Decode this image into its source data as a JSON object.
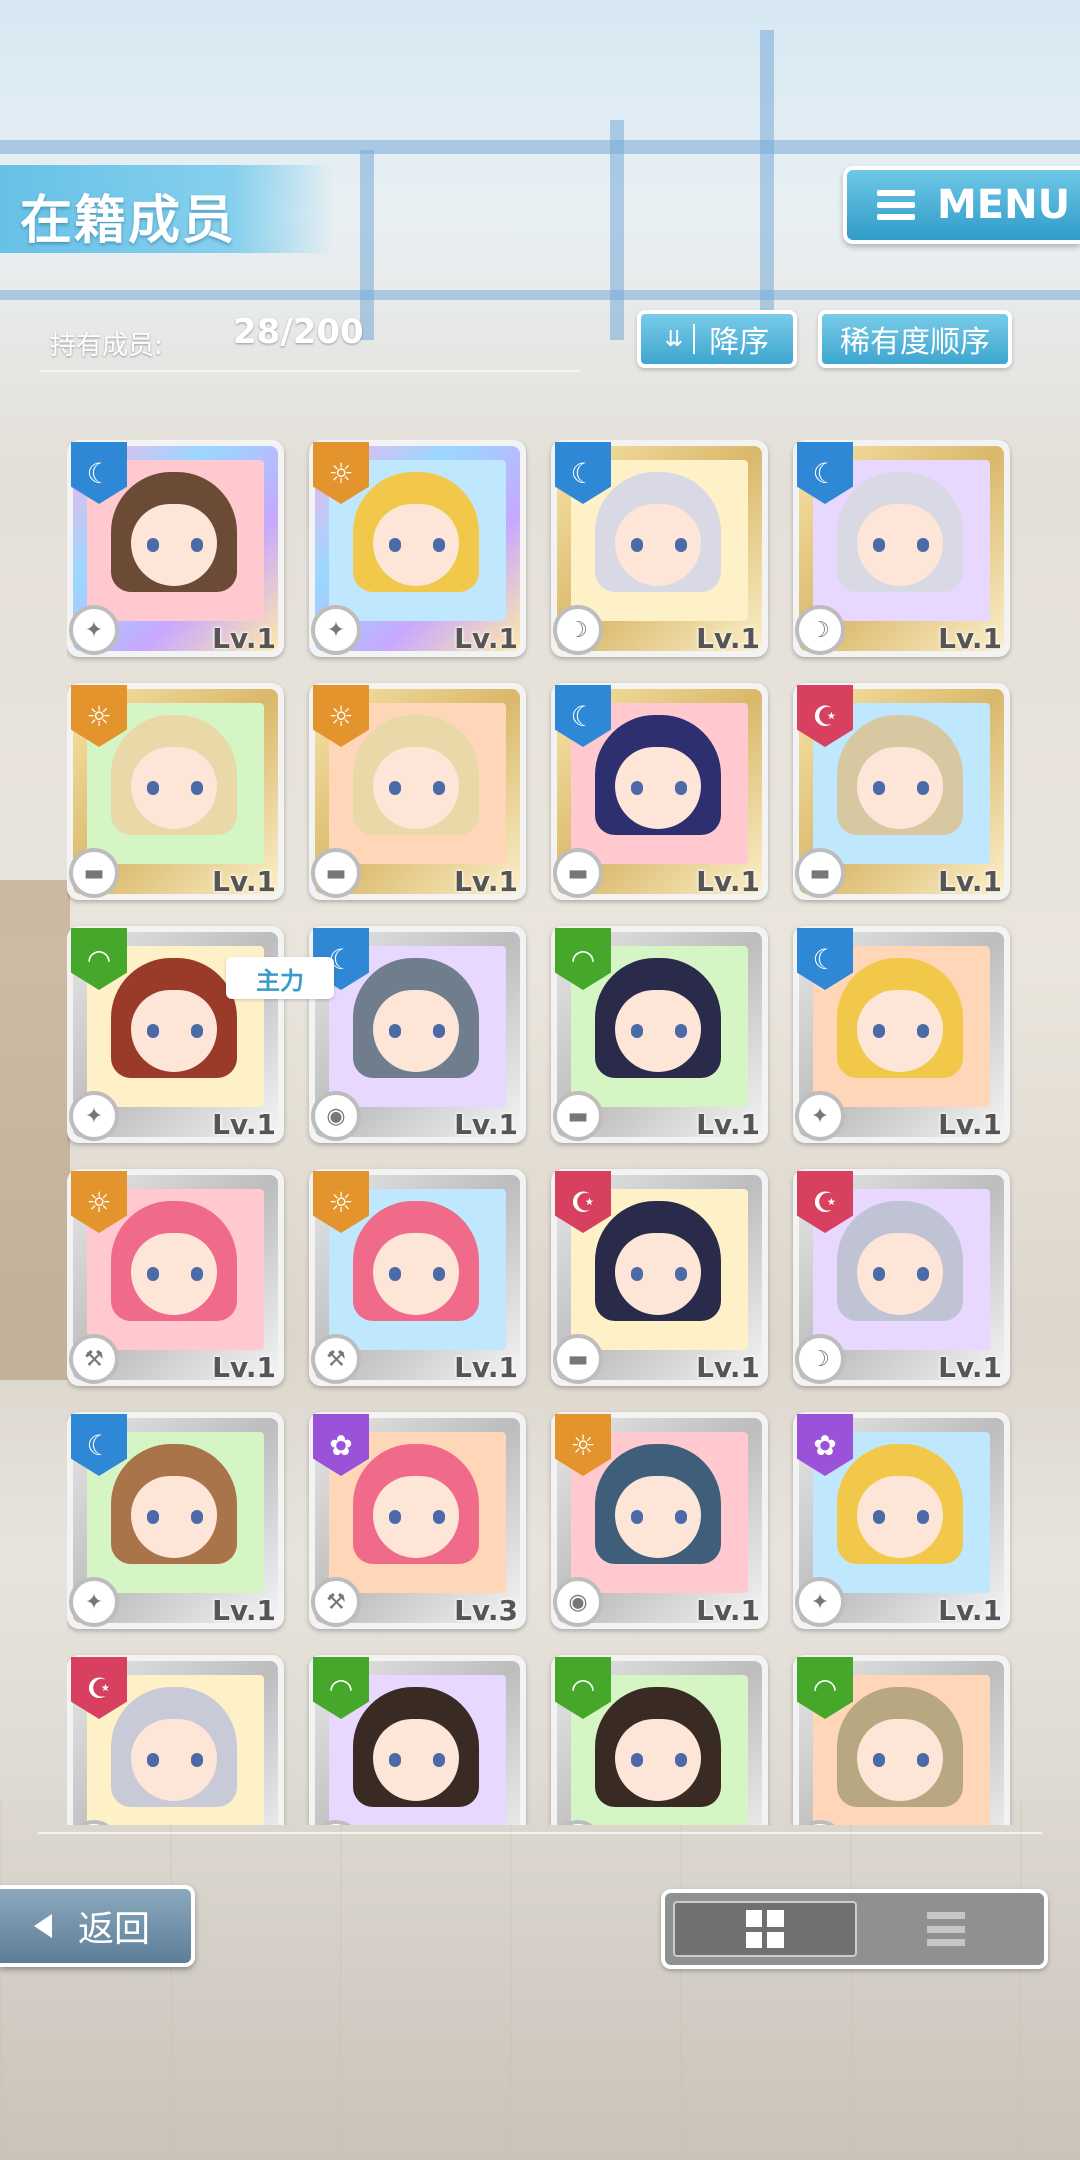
{
  "header": {
    "title": "在籍成员",
    "menu_label": "MENU"
  },
  "roster": {
    "count_label": "持有成员:",
    "count_value": "28/200"
  },
  "sort": {
    "order_label": "降序",
    "rarity_label": "稀有度顺序"
  },
  "main_tag": "主力",
  "footer": {
    "back_label": "返回"
  },
  "colors": {
    "accent": "#3ea6cf",
    "attr_blue": "#2f88d6",
    "attr_orange": "#e3942c",
    "attr_green": "#45a82a",
    "attr_pink": "#d8405f",
    "attr_purple": "#9a52d8"
  },
  "cards": [
    {
      "attr": "blue",
      "weapon": "sword-icon",
      "level": "Lv.1",
      "frame": "rainbow"
    },
    {
      "attr": "orange",
      "weapon": "sword-icon",
      "level": "Lv.1",
      "frame": "rainbow"
    },
    {
      "attr": "blue",
      "weapon": "scythe-icon",
      "level": "Lv.1",
      "frame": "gold"
    },
    {
      "attr": "blue",
      "weapon": "scythe-icon",
      "level": "Lv.1",
      "frame": "gold"
    },
    {
      "attr": "orange",
      "weapon": "gun-icon",
      "level": "Lv.1",
      "frame": "gold"
    },
    {
      "attr": "orange",
      "weapon": "gun-icon",
      "level": "Lv.1",
      "frame": "gold"
    },
    {
      "attr": "blue",
      "weapon": "gun-icon",
      "level": "Lv.1",
      "frame": "gold"
    },
    {
      "attr": "pink",
      "weapon": "gun-icon",
      "level": "Lv.1",
      "frame": "gold"
    },
    {
      "attr": "green",
      "weapon": "sword-icon",
      "level": "Lv.1",
      "frame": "silver"
    },
    {
      "attr": "blue",
      "weapon": "shield-icon",
      "level": "Lv.1",
      "frame": "silver"
    },
    {
      "attr": "green",
      "weapon": "gun-icon",
      "level": "Lv.1",
      "frame": "silver"
    },
    {
      "attr": "blue",
      "weapon": "sword-icon",
      "level": "Lv.1",
      "frame": "silver"
    },
    {
      "attr": "orange",
      "weapon": "hammer-icon",
      "level": "Lv.1",
      "frame": "silver"
    },
    {
      "attr": "orange",
      "weapon": "hammer-icon",
      "level": "Lv.1",
      "frame": "silver"
    },
    {
      "attr": "pink",
      "weapon": "gun-icon",
      "level": "Lv.1",
      "frame": "silver"
    },
    {
      "attr": "pink",
      "weapon": "scythe-icon",
      "level": "Lv.1",
      "frame": "silver"
    },
    {
      "attr": "blue",
      "weapon": "sword-icon",
      "level": "Lv.1",
      "frame": "silver"
    },
    {
      "attr": "purple",
      "weapon": "hammer-icon",
      "level": "Lv.3",
      "frame": "silver"
    },
    {
      "attr": "orange",
      "weapon": "shield-icon",
      "level": "Lv.1",
      "frame": "silver"
    },
    {
      "attr": "purple",
      "weapon": "sword-icon",
      "level": "Lv.1",
      "frame": "silver"
    },
    {
      "attr": "pink",
      "weapon": "sword-icon",
      "level": "",
      "frame": "silver"
    },
    {
      "attr": "green",
      "weapon": "sword-icon",
      "level": "",
      "frame": "silver"
    },
    {
      "attr": "green",
      "weapon": "sword-icon",
      "level": "",
      "frame": "silver"
    },
    {
      "attr": "green",
      "weapon": "sword-icon",
      "level": "",
      "frame": "silver"
    }
  ]
}
